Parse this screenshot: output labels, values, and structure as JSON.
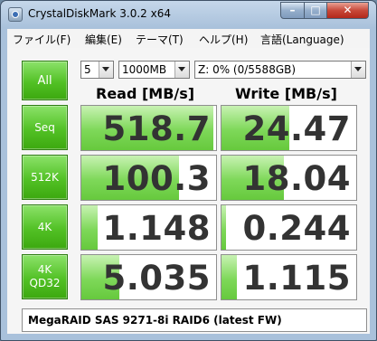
{
  "window": {
    "title": "CrystalDiskMark 3.0.2 x64"
  },
  "controls": {
    "minimize": "–",
    "maximize": "□",
    "close": "✕"
  },
  "menu": [
    "ファイル(F)",
    "編集(E)",
    "テーマ(T)",
    "ヘルプ(H)",
    "言語(Language)"
  ],
  "toolbar": {
    "all_label": "All",
    "runs": "5",
    "size": "1000MB",
    "drive": "Z: 0% (0/5588GB)"
  },
  "headers": {
    "read": "Read [MB/s]",
    "write": "Write [MB/s]"
  },
  "rows": [
    {
      "label": [
        "Seq"
      ],
      "read": "518.7",
      "write": "24.47",
      "read_value": 518.7,
      "write_value": 24.47
    },
    {
      "label": [
        "512K"
      ],
      "read": "100.3",
      "write": "18.04",
      "read_value": 100.3,
      "write_value": 18.04
    },
    {
      "label": [
        "4K"
      ],
      "read": "1.148",
      "write": "0.244",
      "read_value": 1.148,
      "write_value": 0.244
    },
    {
      "label": [
        "4K",
        "QD32"
      ],
      "read": "5.035",
      "write": "1.115",
      "read_value": 5.035,
      "write_value": 1.115
    }
  ],
  "comment": "MegaRAID SAS 9271-8i RAID6 (latest FW)",
  "colors": {
    "button": "#52c125",
    "bar": "#7ed859"
  }
}
